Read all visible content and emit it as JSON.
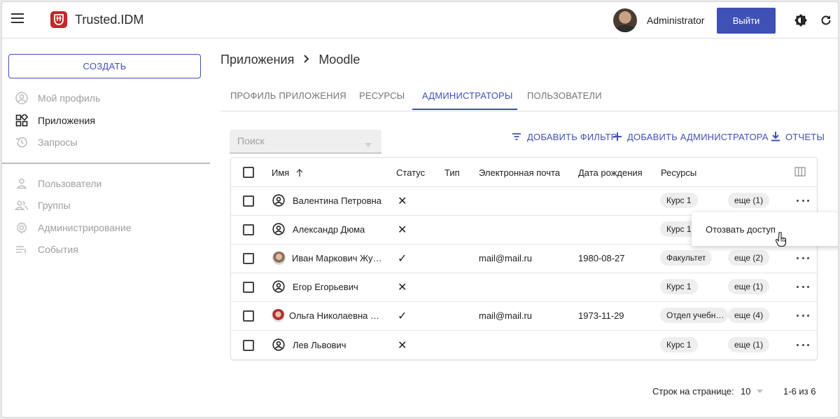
{
  "header": {
    "brand": "Trusted.IDM",
    "user_name": "Administrator",
    "logout_label": "Выйти"
  },
  "sidebar": {
    "create_label": "СОЗДАТЬ",
    "items": [
      {
        "label": "Мой профиль",
        "icon": "account-circle-icon"
      },
      {
        "label": "Приложения",
        "icon": "apps-icon"
      },
      {
        "label": "Запросы",
        "icon": "history-icon"
      },
      {
        "label": "Пользователи",
        "icon": "person-icon"
      },
      {
        "label": "Группы",
        "icon": "group-icon"
      },
      {
        "label": "Администрирование",
        "icon": "gear-icon"
      },
      {
        "label": "События",
        "icon": "events-list-icon"
      }
    ]
  },
  "breadcrumb": {
    "parent": "Приложения",
    "current": "Moodle"
  },
  "tabs": [
    {
      "label": "ПРОФИЛЬ ПРИЛОЖЕНИЯ"
    },
    {
      "label": "РЕСУРСЫ"
    },
    {
      "label": "АДМИНИСТРАТОРЫ"
    },
    {
      "label": "ПОЛЬЗОВАТЕЛИ"
    }
  ],
  "toolbar": {
    "search_placeholder": "Поиск",
    "add_filter": "ДОБАВИТЬ ФИЛЬТР",
    "add_admin": "ДОБАВИТЬ АДМИНИСТРАТОРА",
    "reports": "ОТЧЕТЫ"
  },
  "table": {
    "columns": {
      "name": "Имя",
      "status": "Статус",
      "type": "Тип",
      "email": "Электронная почта",
      "birth": "Дата рождения",
      "resources": "Ресурсы"
    },
    "rows": [
      {
        "name": "Валентина Петровна",
        "avatar": "person-icon",
        "status": "✕",
        "email": "",
        "birth": "",
        "resource": "Курс 1",
        "more": "еще (1)"
      },
      {
        "name": "Александр Дюма",
        "avatar": "person-icon",
        "status": "✕",
        "email": "",
        "birth": "",
        "resource": "Курс 1",
        "more": ""
      },
      {
        "name": "Иван Маркович Жу…",
        "avatar": "photo",
        "status": "✓",
        "email": "mail@mail.ru",
        "birth": "1980-08-27",
        "resource": "Факультет",
        "more": "еще (2)"
      },
      {
        "name": "Егор Егорьевич",
        "avatar": "person-icon",
        "status": "✕",
        "email": "",
        "birth": "",
        "resource": "Курс 1",
        "more": "еще (1)"
      },
      {
        "name": "Ольга Николаевна …",
        "avatar": "photo",
        "status": "✓",
        "email": "mail@mail.ru",
        "birth": "1973-11-29",
        "resource": "Отдел учебн…",
        "more": "еще (4)"
      },
      {
        "name": "Лев Львович",
        "avatar": "person-icon",
        "status": "✕",
        "email": "",
        "birth": "",
        "resource": "Курс 1",
        "more": "еще (1)"
      }
    ]
  },
  "context_menu": {
    "revoke_label": "Отозвать доступ"
  },
  "pagination": {
    "rows_per_page_label": "Строк на странице:",
    "rows_per_page_value": "10",
    "range": "1-6 из 6"
  },
  "colors": {
    "accent": "#3f51b5",
    "logo": "#c62828"
  }
}
